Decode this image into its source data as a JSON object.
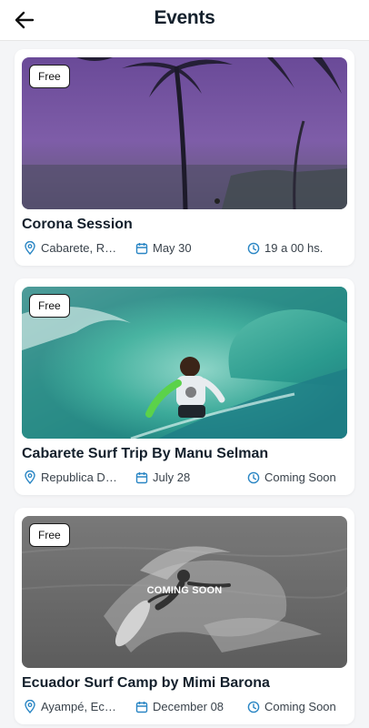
{
  "header": {
    "title": "Events"
  },
  "colors": {
    "accent": "#2a86c4",
    "title": "#14202c"
  },
  "events": [
    {
      "badge": "Free",
      "title": "Corona Session",
      "location": "Cabarete, Re...",
      "date": "May 30",
      "time": "19 a 00 hs.",
      "overlay": ""
    },
    {
      "badge": "Free",
      "title": "Cabarete Surf Trip By Manu Selman",
      "location": "Republica Do...",
      "date": "July 28",
      "time": "Coming Soon",
      "overlay": ""
    },
    {
      "badge": "Free",
      "title": "Ecuador Surf Camp by Mimi Barona",
      "location": "Ayampé, Ecu...",
      "date": "December 08",
      "time": "Coming Soon",
      "overlay": "COMING SOON"
    }
  ]
}
